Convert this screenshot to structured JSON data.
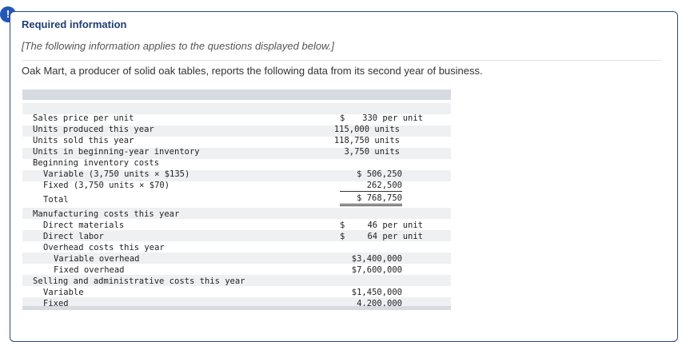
{
  "alert_icon": {
    "glyph": "!",
    "name": "alert-icon"
  },
  "header": {
    "title": "Required information",
    "subtitle": "[The following information applies to the questions displayed below.]"
  },
  "intro": "Oak Mart, a producer of solid oak tables, reports the following data from its second year of business.",
  "table": {
    "sales_price": {
      "label": "Sales price per unit",
      "dollar": "$",
      "value": "330 per unit"
    },
    "units_produced": {
      "label": "Units produced this year",
      "value": "115,000 units"
    },
    "units_sold": {
      "label": "Units sold this year",
      "value": "118,750 units"
    },
    "units_beginning": {
      "label": "Units in beginning-year inventory",
      "value": "3,750 units"
    },
    "beginning_costs": {
      "label": "Beginning inventory costs"
    },
    "variable_beg": {
      "label": "Variable (3,750 units × $135)",
      "value": "$ 506,250"
    },
    "fixed_beg": {
      "label": "Fixed (3,750 units × $70)",
      "value": "262,500"
    },
    "total_beg": {
      "label": "Total",
      "value": "$ 768,750"
    },
    "mfg_costs": {
      "label": "Manufacturing costs this year"
    },
    "direct_materials": {
      "label": "Direct materials",
      "dollar": "$",
      "value": "46 per unit"
    },
    "direct_labor": {
      "label": "Direct labor",
      "dollar": "$",
      "value": "64 per unit"
    },
    "overhead": {
      "label": "Overhead costs this year"
    },
    "variable_overhead": {
      "label": "Variable overhead",
      "value": "$3,400,000"
    },
    "fixed_overhead": {
      "label": "Fixed overhead",
      "value": "$7,600,000"
    },
    "selling_admin": {
      "label": "Selling and administrative costs this year"
    },
    "sa_variable": {
      "label": "Variable",
      "value": "$1,450,000"
    },
    "sa_fixed": {
      "label": "Fixed",
      "value": "4,200,000"
    }
  }
}
